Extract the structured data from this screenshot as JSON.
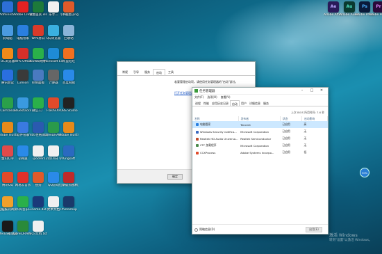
{
  "desktop_icons": [
    {
      "label": "Administ...",
      "color": "#2d6fd6"
    },
    {
      "label": "Adobe Creati...",
      "color": "#e32222"
    },
    {
      "label": "锐图鉴赏.xls",
      "color": "#1d7a3a"
    },
    {
      "label": "乐享二",
      "color": "#f0f0f0"
    },
    {
      "label": "飞书截图.png",
      "color": "#e05a2a"
    },
    {
      "label": "此电脑",
      "color": "#4a9ae0"
    },
    {
      "label": "电脑管家",
      "color": "#2a7fe0"
    },
    {
      "label": "WPS办公",
      "color": "#d93a2a"
    },
    {
      "label": "QQ浏览器",
      "color": "#3ab0e0"
    },
    {
      "label": "回收站",
      "color": "#8ab4d8"
    },
    {
      "label": "UC浏览器",
      "color": "#f08a1a"
    },
    {
      "label": "WPS Office",
      "color": "#d6302a"
    },
    {
      "label": "360Wo网络...",
      "color": "#2ab04a"
    },
    {
      "label": "Microsoft Edge",
      "color": "#1e8bd6"
    },
    {
      "label": "阿里旺旺",
      "color": "#f07020"
    },
    {
      "label": "腾讯会议",
      "color": "#2a6fe0"
    },
    {
      "label": "Lumion",
      "color": "#3a3a3a"
    },
    {
      "label": "控制面板",
      "color": "#4a7ac0"
    },
    {
      "label": "计算器",
      "color": "#666"
    },
    {
      "label": "百度网盘",
      "color": "#2a8ae8"
    },
    {
      "label": "Camtasia",
      "color": "#2aa04a"
    },
    {
      "label": "Bluestacks",
      "color": "#3a9ae0"
    },
    {
      "label": "微信工厂",
      "color": "#2ab04a"
    },
    {
      "label": "FlashFXP",
      "color": "#e04a2a"
    },
    {
      "label": "OBS Studio",
      "color": "#222"
    },
    {
      "label": "Adobe Illustrat...",
      "color": "#e68a1a"
    },
    {
      "label": "软件管家",
      "color": "#3a7ae0"
    },
    {
      "label": "mbti性格测试.docx",
      "color": "#2a5ab0"
    },
    {
      "label": "CorelDRAW 2020",
      "color": "#2a9a4a"
    },
    {
      "label": "Adobe Illustrat...",
      "color": "#e68a1a"
    },
    {
      "label": "金山打字",
      "color": "#e04a4a"
    },
    {
      "label": "ip网速",
      "color": "#2a8ae8"
    },
    {
      "label": "ipoofer",
      "color": "#f0f0f0"
    },
    {
      "label": "12月14日 学习数据",
      "color": "#f0f0f0"
    },
    {
      "label": "Kingsoft",
      "color": "#2a6ac0"
    },
    {
      "label": "腾讯QQ",
      "color": "#e04a2a"
    },
    {
      "label": "网易云音乐",
      "color": "#e0302a"
    },
    {
      "label": "搜狗",
      "color": "#e05a2a"
    },
    {
      "label": "QQ游戏",
      "color": "#2a8ae8"
    },
    {
      "label": "红蜻蜓抓图精灵",
      "color": "#c02a2a"
    },
    {
      "label": "电脑报刊阅读",
      "color": "#f0a02a"
    },
    {
      "label": "QQ音乐",
      "color": "#2ab04a"
    },
    {
      "label": "Cinema 4D R20",
      "color": "#1a3a7a"
    },
    {
      "label": "文本文档",
      "color": "#f0f0f0"
    },
    {
      "label": "Photoshop",
      "color": "#1a3a6a"
    },
    {
      "label": "Media播放器",
      "color": "#1a1a1a"
    },
    {
      "label": "CorelDRAW 2017 (64-...",
      "color": "#2a8a3a"
    },
    {
      "label": "学习文档.txt",
      "color": "#f0f0f0"
    }
  ],
  "top_right_icons": [
    {
      "label": "Adobe After Effects CC",
      "glyph": "Ae",
      "color": "#2a1a5a",
      "text_color": "#b9a8ff"
    },
    {
      "label": "Adobe Audition",
      "glyph": "Au",
      "color": "#0a3a30",
      "text_color": "#4ae0c0"
    },
    {
      "label": "Adobe Photoshop",
      "glyph": "Ps",
      "color": "#0a1a3a",
      "text_color": "#4ab0ff"
    },
    {
      "label": "Adobe Premiere",
      "glyph": "Pr",
      "color": "#2a0a3a",
      "text_color": "#e08aff"
    }
  ],
  "msconfig": {
    "tabs": [
      "常规",
      "引导",
      "服务",
      "启动",
      "工具"
    ],
    "active_tab": 3,
    "message": "若要管理启动项，请使用任务管理器的\"启动\"部分。",
    "link": "打开任务管理器",
    "ok_label": "确定"
  },
  "task_manager": {
    "title": "任务管理器",
    "controls": [
      "–",
      "□",
      "✕"
    ],
    "menu": [
      "文件(F)",
      "选项(O)",
      "查看(V)"
    ],
    "tabs": [
      "进程",
      "性能",
      "应用历史记录",
      "启动",
      "用户",
      "详细信息",
      "服务"
    ],
    "active_tab": 3,
    "bios_info": "上次 BIOS 所用时间:  7.6 秒",
    "columns": [
      "名称",
      "发布者",
      "状态",
      "启动影响"
    ],
    "rows": [
      {
        "name": "电脑管家",
        "publisher": "Tencent",
        "status": "已启用",
        "impact": "高",
        "icon_color": "#2a7fe0",
        "selected": true
      },
      {
        "name": "Windows Security notifica...",
        "publisher": "Microsoft Corporation",
        "status": "已启用",
        "impact": "无",
        "icon_color": "#3a6ac0",
        "selected": false
      },
      {
        "name": "Realtek HD Audio Universa...",
        "publisher": "Realtek Semiconductor",
        "status": "已启用",
        "impact": "无",
        "icon_color": "#c04a2a",
        "selected": false
      },
      {
        "name": "CTF 加载程序",
        "publisher": "Microsoft Corporation",
        "status": "已启用",
        "impact": "无",
        "icon_color": "#4a8a4a",
        "selected": false
      },
      {
        "name": "CCXProcess",
        "publisher": "Adobe Systems Incorpo...",
        "status": "已启用",
        "impact": "低",
        "icon_color": "#e04a2a",
        "selected": false
      }
    ],
    "fewer_details": "简略信息(D)",
    "enable_button": "启用(E)"
  },
  "watermark": {
    "line1": "激活 Windows",
    "line2": "转到\"设置\"以激活 Windows。"
  },
  "bubble_label": "50%"
}
